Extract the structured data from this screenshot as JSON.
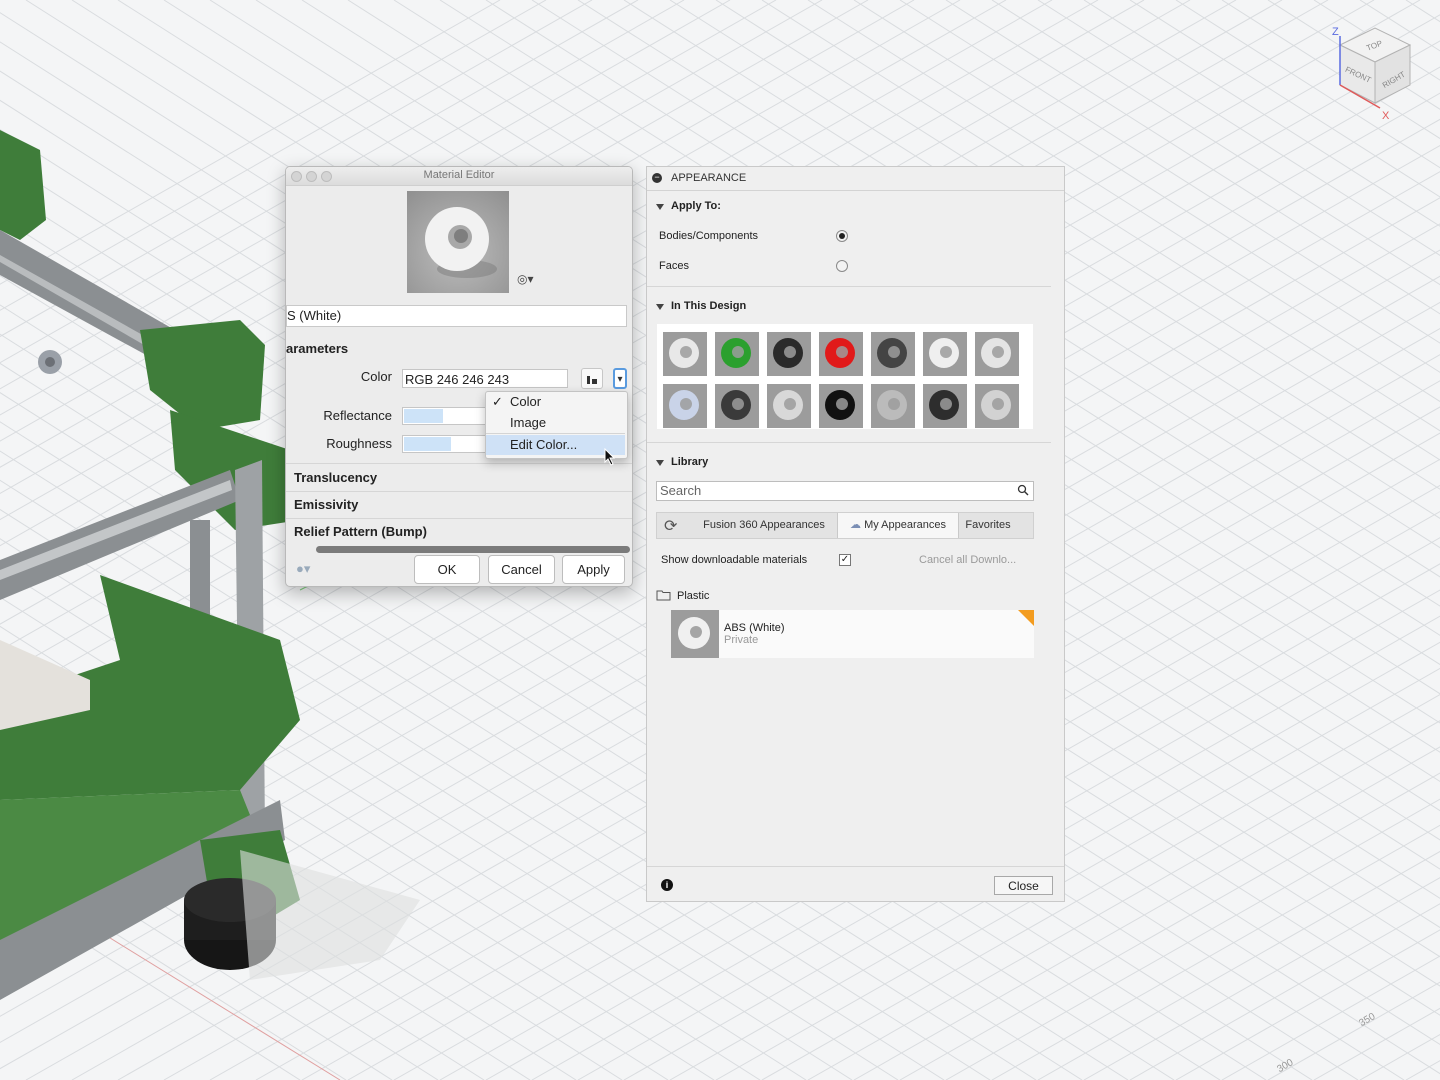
{
  "viewport": {
    "viewcube": {
      "top": "TOP",
      "front": "FRONT",
      "right": "RIGHT",
      "z_axis": "Z",
      "x_axis": "X"
    },
    "grid_labels": [
      "350",
      "300"
    ]
  },
  "material_editor": {
    "title": "Material Editor",
    "name": "S (White)",
    "parameters_heading": "arameters",
    "color_label": "Color",
    "color_value": "RGB 246 246 243",
    "reflectance_label": "Reflectance",
    "reflectance_level": 0.45,
    "roughness_label": "Roughness",
    "roughness_level": 0.55,
    "sections": [
      "Translucency",
      "Emissivity",
      "Relief Pattern (Bump)"
    ],
    "buttons": {
      "ok": "OK",
      "cancel": "Cancel",
      "apply": "Apply"
    },
    "color_menu": {
      "items": [
        "Color",
        "Image",
        "Edit Color..."
      ],
      "checked": "Color",
      "highlighted": "Edit Color..."
    }
  },
  "appearance_panel": {
    "title": "APPEARANCE",
    "apply_to": {
      "heading": "Apply To:",
      "options": [
        "Bodies/Components",
        "Faces"
      ],
      "selected": "Bodies/Components"
    },
    "in_this_design": {
      "heading": "In This Design",
      "swatches": [
        "#e8e8e8",
        "#2ba02e",
        "#2a2a2a",
        "#e11a1a",
        "#444444",
        "#efefef",
        "#e4e4e4",
        "#c9d3e8",
        "#3a3a3a",
        "#d8d8d8",
        "#111111",
        "#bbbbbb",
        "#2d2d2d",
        "#d2d2d2"
      ]
    },
    "library": {
      "heading": "Library",
      "search_placeholder": "Search",
      "tabs": [
        "Fusion 360 Appearances",
        "My Appearances",
        "Favorites"
      ],
      "active_tab": "My Appearances",
      "show_downloadable_label": "Show downloadable materials",
      "show_downloadable_checked": true,
      "cancel_downloads": "Cancel all Downlo...",
      "folder": "Plastic",
      "material": {
        "name": "ABS (White)",
        "sub": "Private"
      }
    },
    "close_label": "Close"
  }
}
